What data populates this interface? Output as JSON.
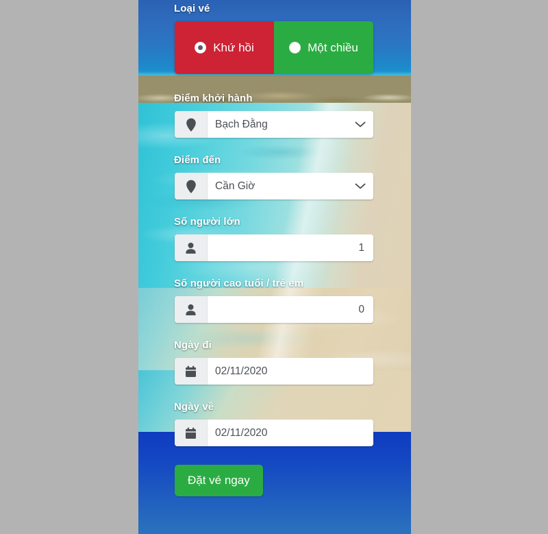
{
  "app": {
    "language": "vi"
  },
  "ticket_type": {
    "label": "Loại vé",
    "options": [
      {
        "label": "Khứ hồi",
        "selected": true,
        "color": "#ce2235"
      },
      {
        "label": "Một chiều",
        "selected": false,
        "color": "#2bac42"
      }
    ]
  },
  "fields": {
    "departure_point": {
      "label": "Điểm khởi hành",
      "value": "Bạch Đằng",
      "icon": "map-pin-icon",
      "control": "select"
    },
    "destination_point": {
      "label": "Điểm đến",
      "value": "Cần Giờ",
      "icon": "map-pin-icon",
      "control": "select"
    },
    "adults": {
      "label": "Số người lớn",
      "value": "1",
      "icon": "person-icon",
      "control": "number"
    },
    "seniors_children": {
      "label": "Số người cao tuổi / trẻ em",
      "value": "0",
      "icon": "person-icon",
      "control": "number"
    },
    "departure_date": {
      "label": "Ngày đi",
      "value": "02/11/2020",
      "icon": "calendar-icon",
      "control": "date"
    },
    "return_date": {
      "label": "Ngày về",
      "value": "02/11/2020",
      "icon": "calendar-icon",
      "control": "date"
    }
  },
  "submit": {
    "label": "Đặt vé ngay",
    "color": "#2bac42"
  },
  "colors": {
    "page_backdrop": "#b3b3b3",
    "panel_blue": "#1447c3",
    "accent_red": "#ce2235",
    "accent_green": "#2bac42",
    "field_addon": "#eceeef",
    "field_bg": "#ffffff",
    "label_text": "#ffffff",
    "value_text": "#4b4f54"
  }
}
